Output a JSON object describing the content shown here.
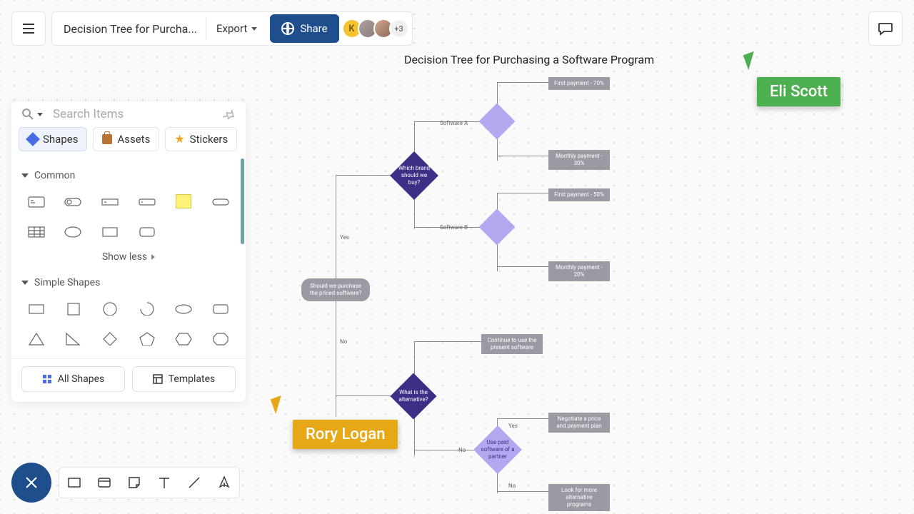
{
  "header": {
    "title": "Decision Tree for Purcha...",
    "export": "Export",
    "share": "Share",
    "avatar_initial": "K",
    "more_count": "+3"
  },
  "panel": {
    "search_placeholder": "Search Items",
    "tabs": {
      "shapes": "Shapes",
      "assets": "Assets",
      "stickers": "Stickers"
    },
    "sections": {
      "common": "Common",
      "simple": "Simple Shapes"
    },
    "show_less": "Show less",
    "all_shapes": "All Shapes",
    "templates": "Templates"
  },
  "chart": {
    "title": "Decision Tree for Purchasing a Software Program",
    "nodes": {
      "root": "Should we purchase the priced software?",
      "brand": "Which brand should we buy?",
      "alt": "What is the alternative?",
      "use_partner": "Use paid software of a partner",
      "swA": "Software A",
      "swB": "Software B",
      "fp70": "First payment - 70%",
      "mp30": "Monthly payment - 30%",
      "fp50": "First payment - 50%",
      "mp20": "Monthly payment - 20%",
      "cont": "Continue to use the present software",
      "neg": "Negotiate a price and payment plan",
      "look": "Look for more alternative programs"
    },
    "labels": {
      "yes": "Yes",
      "no": "No"
    }
  },
  "cursors": {
    "eli": "Eli Scott",
    "rory": "Rory Logan"
  }
}
